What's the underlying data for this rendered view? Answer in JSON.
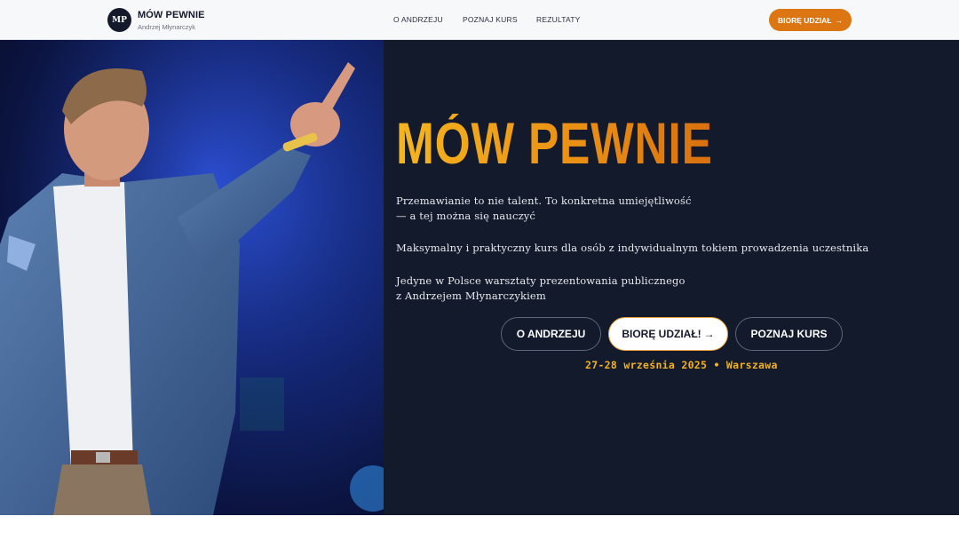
{
  "header": {
    "logo_initials": "MP",
    "brand_name": "MÓW PEWNIE",
    "brand_subtitle": "Andrzej Młynarczyk",
    "nav": [
      {
        "label": "O ANDRZEJU"
      },
      {
        "label": "POZNAJ KURS"
      },
      {
        "label": "REZULTATY"
      }
    ],
    "cta_label": "BIORĘ UDZIAŁ",
    "cta_arrow": "→"
  },
  "hero": {
    "title": "MÓW PEWNIE",
    "tagline_line1": "Przemawianie to nie talent. To konkretna umiejętliwość",
    "tagline_line2": "— a tej można się nauczyć",
    "description": "Maksymalny i praktyczny kurs dla osób z indywidualnym tokiem prowadzenia uczestnika",
    "unique_line1": "Jedyne w Polsce warsztaty prezentowania publicznego",
    "unique_line2": "z Andrzejem Młynarczykiem",
    "buttons": {
      "about": "O ANDRZEJU",
      "join": "BIORĘ UDZIAŁ!",
      "join_arrow": "→",
      "course": "POZNAJ KURS"
    },
    "event_date": "27-28 września 2025 • Warszawa"
  },
  "colors": {
    "accent_orange": "#db7612",
    "title_gold": "#f5b51e",
    "panel_dark": "#131a2b",
    "stage_blue": "#1f3fae"
  }
}
